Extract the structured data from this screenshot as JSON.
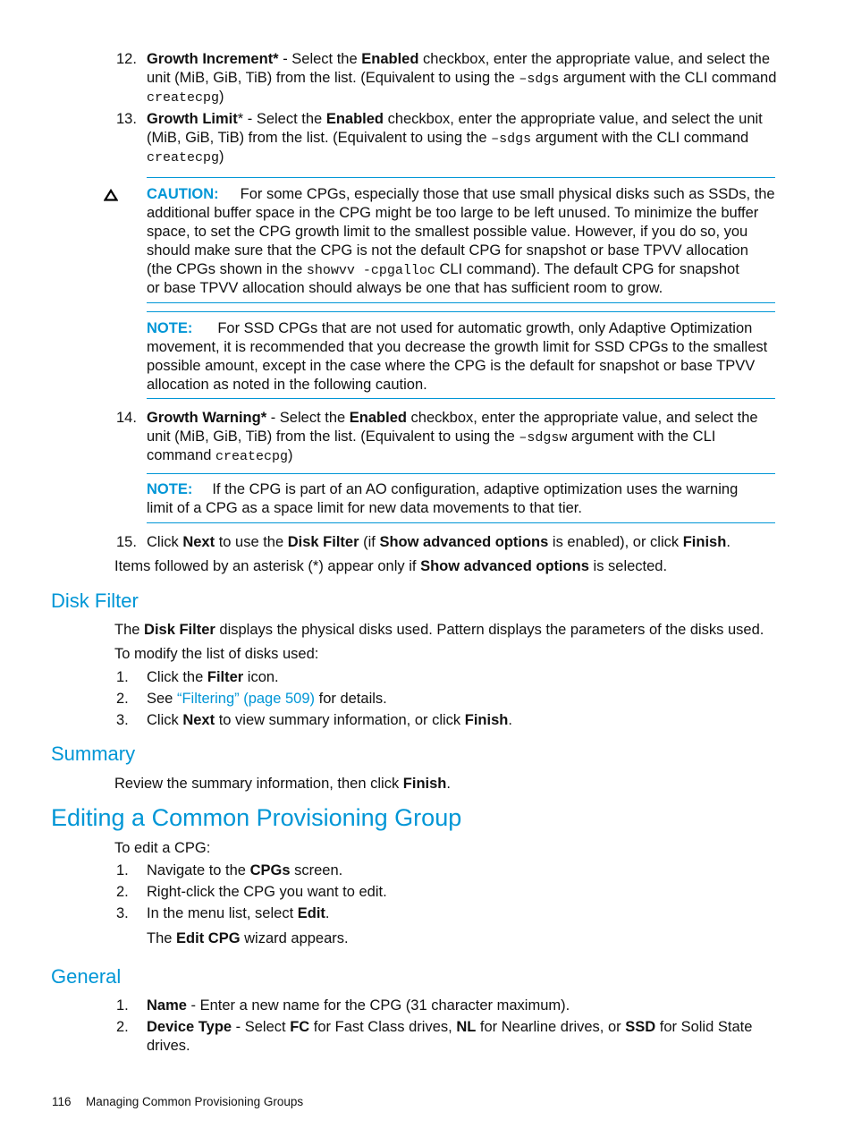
{
  "steps_top": [
    {
      "num": "12.",
      "title": "Growth Increment*",
      "text1": " - Select the ",
      "bold1": "Enabled",
      "text2": " checkbox, enter the appropriate value, and select the",
      "line2a": "unit (MiB, GiB, TiB) from the list. (Equivalent to using the ",
      "code": "–sdgs",
      "line2b": " argument with the CLI command",
      "line3code": "createcpg",
      "line3end": ")"
    },
    {
      "num": "13.",
      "title": "Growth Limit",
      "asterisk": "*",
      "text1": " - Select the ",
      "bold1": "Enabled",
      "text2": " checkbox, enter the appropriate value, and select the unit",
      "line2a": "(MiB, GiB, TiB) from the list. (Equivalent to using the ",
      "code": "–sdgs",
      "line2b": " argument with the CLI command",
      "line3code": "createcpg",
      "line3end": ")"
    }
  ],
  "caution": {
    "icon": "warning-triangle-icon",
    "label": "CAUTION:",
    "lines": [
      "For some CPGs, especially those that use small physical disks such as SSDs, the",
      "additional buffer space in the CPG might be too large to be left unused. To minimize the buffer",
      "space, to set the CPG growth limit to the smallest possible value. However, if you do so, you",
      "should make sure that the CPG is not the default CPG for snapshot or base TPVV allocation"
    ],
    "line5a": "(the CPGs shown in the ",
    "line5code": "showvv -cpgalloc",
    "line5b": " CLI command). The default CPG for snapshot",
    "line6": "or base TPVV allocation should always be one that has sufficient room to grow."
  },
  "note1": {
    "label": "NOTE:",
    "lines": [
      "For SSD CPGs that are not used for automatic growth, only Adaptive Optimization",
      "movement, it is recommended that you decrease the growth limit for SSD CPGs to the smallest",
      "possible amount, except in the case where the CPG is the default for snapshot or base TPVV",
      "allocation as noted in the following caution."
    ]
  },
  "step14": {
    "num": "14.",
    "title": "Growth Warning*",
    "text1": " - Select the ",
    "bold1": "Enabled",
    "text2": " checkbox, enter the appropriate value, and select the",
    "line2a": "unit (MiB, GiB, TiB) from the list. (Equivalent to using the ",
    "code": "–sdgsw",
    "line2b": " argument with the CLI",
    "line3a": "command ",
    "line3code": "createcpg",
    "line3end": ")"
  },
  "note2": {
    "label": "NOTE:",
    "lines": [
      "If the CPG is part of an AO configuration, adaptive optimization uses the warning",
      "limit of a CPG as a space limit for new data movements to that tier."
    ]
  },
  "step15": {
    "num": "15.",
    "t1": "Click ",
    "b1": "Next",
    "t2": " to use the ",
    "b2": "Disk Filter",
    "t3": " (if ",
    "b3": "Show advanced options",
    "t4": " is enabled), or click ",
    "b4": "Finish",
    "t5": "."
  },
  "asterisk_note": {
    "t1": "Items followed by an asterisk (*) appear only if ",
    "b1": "Show advanced options",
    "t2": " is selected."
  },
  "disk_filter": {
    "heading": "Disk Filter",
    "p1a": "The ",
    "p1b": "Disk Filter",
    "p1c": " displays the physical disks used. Pattern displays the parameters of the disks used.",
    "p2": "To modify the list of disks used:",
    "items": [
      {
        "num": "1.",
        "t1": "Click the ",
        "b1": "Filter",
        "t2": " icon."
      },
      {
        "num": "2.",
        "t1": "See ",
        "link": "“Filtering” (page 509)",
        "t2": " for details."
      },
      {
        "num": "3.",
        "t1": "Click ",
        "b1": "Next",
        "t2": " to view summary information, or click ",
        "b2": "Finish",
        "t3": "."
      }
    ]
  },
  "summary": {
    "heading": "Summary",
    "t1": "Review the summary information, then click ",
    "b1": "Finish",
    "t2": "."
  },
  "editing": {
    "heading": "Editing a Common Provisioning Group",
    "intro": "To edit a CPG:",
    "items": [
      {
        "num": "1.",
        "t1": "Navigate to the ",
        "b1": "CPGs",
        "t2": " screen."
      },
      {
        "num": "2.",
        "t1": "Right-click the CPG you want to edit."
      },
      {
        "num": "3.",
        "t1": "In the menu list, select ",
        "b1": "Edit",
        "t2": "."
      }
    ],
    "result_a": "The ",
    "result_b": "Edit CPG",
    "result_c": " wizard appears."
  },
  "general": {
    "heading": "General",
    "items": [
      {
        "num": "1.",
        "b1": "Name",
        "t1": " - Enter a new name for the CPG (31 character maximum)."
      },
      {
        "num": "2.",
        "b1": "Device Type",
        "t1": " - Select ",
        "b2": "FC",
        "t2": " for Fast Class drives, ",
        "b3": "NL",
        "t3": " for Nearline drives, or ",
        "b4": "SSD",
        "t4": " for Solid State",
        "line2": "drives."
      }
    ]
  },
  "footer": {
    "page_number": "116",
    "chapter": "Managing Common Provisioning Groups"
  }
}
